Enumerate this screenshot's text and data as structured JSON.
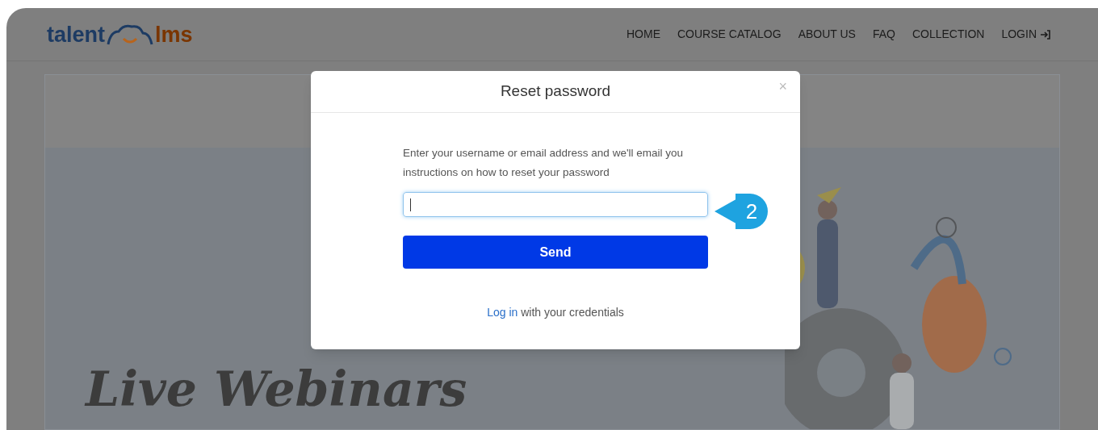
{
  "header": {
    "logo": {
      "first": "talent",
      "second": "lms"
    },
    "nav": [
      {
        "label": "HOME",
        "kind": "link"
      },
      {
        "label": "COURSE CATALOG",
        "kind": "link"
      },
      {
        "label": "ABOUT US",
        "kind": "link"
      },
      {
        "label": "FAQ",
        "kind": "link"
      },
      {
        "label": "COLLECTION",
        "kind": "link"
      },
      {
        "label": "LOGIN",
        "kind": "login"
      }
    ]
  },
  "hero": {
    "title": "Live Webinars"
  },
  "modal": {
    "title": "Reset password",
    "close": "×",
    "instructions": "Enter your username or email address and we'll email you instructions on how to reset your password",
    "input": {
      "focused": true
    },
    "button": "Send",
    "footer": {
      "link": "Log in",
      "text": "with your credentials"
    }
  },
  "callout": {
    "number": "2"
  }
}
